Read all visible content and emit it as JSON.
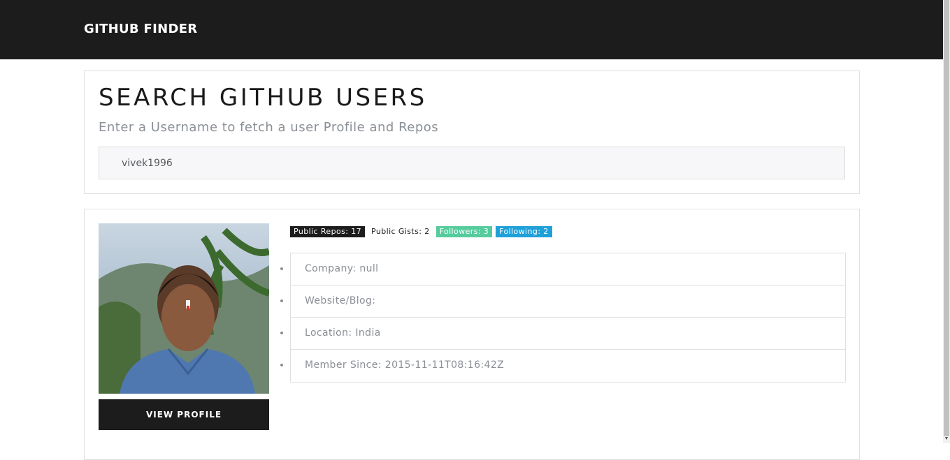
{
  "navbar": {
    "brand": "GITHUB FINDER"
  },
  "search": {
    "title": "SEARCH GITHUB USERS",
    "subtitle": "Enter a Username to fetch a user Profile and Repos",
    "value": "vivek1996"
  },
  "profile": {
    "view_profile_label": "VIEW PROFILE",
    "badges": {
      "public_repos": "Public Repos: 17",
      "public_gists": "Public Gists: 2",
      "followers": "Followers: 3",
      "following": "Following: 2"
    },
    "details": {
      "company": "Company: null",
      "website": "Website/Blog:",
      "location": "Location: India",
      "member_since": "Member Since: 2015-11-11T08:16:42Z"
    }
  },
  "colors": {
    "navbar_bg": "#1c1c1c",
    "followers_badge": "#56cc9d",
    "following_badge": "#1fa0d8"
  }
}
